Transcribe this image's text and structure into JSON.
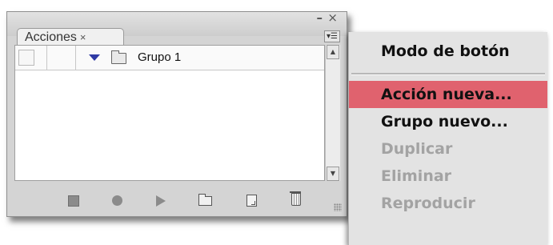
{
  "panel": {
    "tab_label": "Acciones",
    "tab_close": "×",
    "minimize": "–",
    "close": "×",
    "menu_button": "▾☰",
    "rows": [
      {
        "name": "Grupo 1",
        "expanded": true,
        "icon": "folder-icon",
        "checked": false
      }
    ],
    "toolbar_icons": [
      "stop-icon",
      "record-icon",
      "play-icon",
      "new-set-icon",
      "new-action-icon",
      "trash-icon"
    ]
  },
  "menu": {
    "items": [
      {
        "label": "Modo de botón",
        "state": "normal"
      },
      {
        "label": "Acción nueva...",
        "state": "highlighted"
      },
      {
        "label": "Grupo nuevo...",
        "state": "normal"
      },
      {
        "label": "Duplicar",
        "state": "disabled"
      },
      {
        "label": "Eliminar",
        "state": "disabled"
      },
      {
        "label": "Reproducir",
        "state": "disabled"
      }
    ],
    "highlight_color": "#e0626e"
  }
}
